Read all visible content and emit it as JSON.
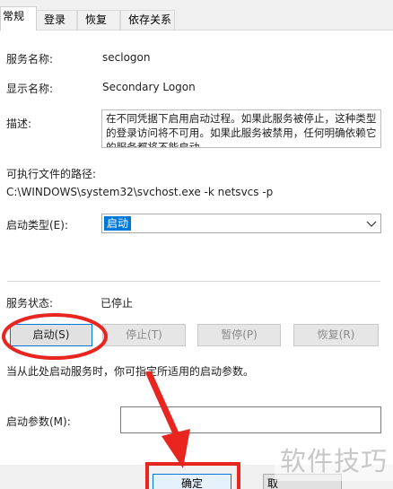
{
  "tabs": [
    {
      "label": "常规",
      "active": true
    },
    {
      "label": "登录",
      "active": false
    },
    {
      "label": "恢复",
      "active": false
    },
    {
      "label": "依存关系",
      "active": false
    }
  ],
  "service": {
    "name_label": "服务名称:",
    "name_value": "seclogon",
    "display_label": "显示名称:",
    "display_value": "Secondary Logon",
    "desc_label": "描述:",
    "desc_value": "在不同凭据下启用启动过程。如果此服务被停止，这种类型的登录访问将不可用。如果此服务被禁用，任何明确依赖它的服务都将不能启动。",
    "path_label": "可执行文件的路径:",
    "path_value": "C:\\WINDOWS\\system32\\svchost.exe -k netsvcs -p",
    "startup_type_label": "启动类型(E):",
    "startup_type_value": "启动",
    "status_label": "服务状态:",
    "status_value": "已停止"
  },
  "buttons": {
    "start": "启动(S)",
    "stop": "停止(T)",
    "pause": "暂停(P)",
    "resume": "恢复(R)"
  },
  "hint_text": "当从此处启动服务时，你可指定所适用的启动参数。",
  "params_label": "启动参数(M):",
  "params_value": "",
  "footer": {
    "ok": "确定",
    "cancel": "取"
  },
  "watermark": "软件技巧",
  "colors": {
    "annotation_red": "#e8251f",
    "selection_blue": "#0078d7"
  }
}
